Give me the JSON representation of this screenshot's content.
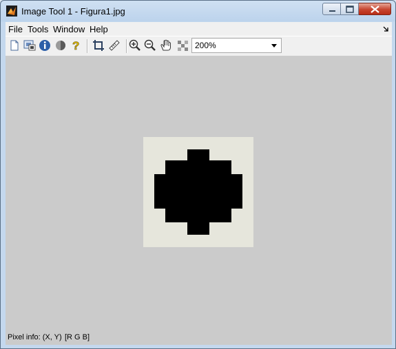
{
  "window": {
    "title": "Image Tool 1 - Figura1.jpg"
  },
  "menu": {
    "items": [
      "File",
      "Tools",
      "Window",
      "Help"
    ]
  },
  "toolbar": {
    "buttons": [
      "new-figure",
      "image-overview",
      "image-information",
      "adjust-contrast",
      "help",
      "crop-image",
      "measure-distance",
      "zoom-in",
      "zoom-out",
      "pan",
      "pixel-region"
    ],
    "zoom_value": "200%"
  },
  "status": {
    "pixel_info_label": "Pixel info: (X, Y)",
    "pixel_value": "[R G B]"
  },
  "image": {
    "background": "#e6e6dc",
    "foreground": "#000000"
  }
}
